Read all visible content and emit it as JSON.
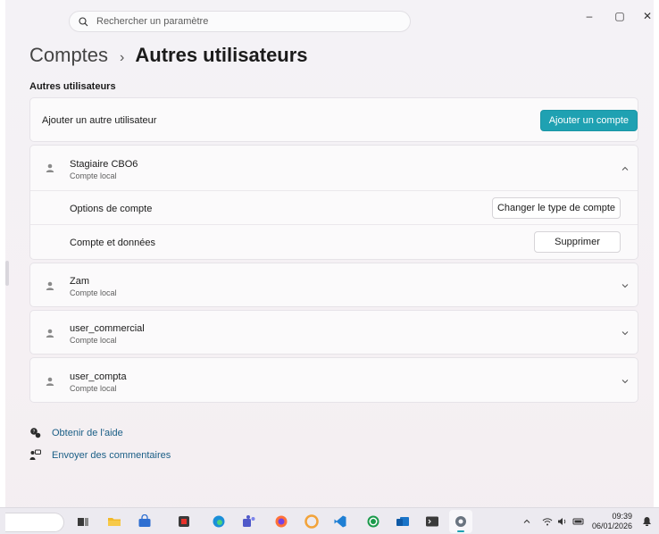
{
  "search": {
    "placeholder": "Rechercher un paramètre"
  },
  "window_controls": {
    "minimize": "–",
    "maximize": "▢",
    "close": "✕"
  },
  "breadcrumb": {
    "parent": "Comptes",
    "separator": "›",
    "current": "Autres utilisateurs"
  },
  "section_title": "Autres utilisateurs",
  "add_user": {
    "label": "Ajouter un autre utilisateur",
    "button": "Ajouter un compte"
  },
  "users": [
    {
      "name": "Stagiaire CBO6",
      "type": "Compte local",
      "expanded": true,
      "options": [
        {
          "label": "Options de compte",
          "button": "Changer le type de compte"
        },
        {
          "label": "Compte et données",
          "button": "Supprimer"
        }
      ]
    },
    {
      "name": "Zam",
      "type": "Compte local",
      "expanded": false
    },
    {
      "name": "user_commercial",
      "type": "Compte local",
      "expanded": false
    },
    {
      "name": "user_compta",
      "type": "Compte local",
      "expanded": false
    }
  ],
  "help_links": [
    {
      "label": "Obtenir de l'aide",
      "icon": "help-icon"
    },
    {
      "label": "Envoyer des commentaires",
      "icon": "feedback-icon"
    }
  ],
  "taskbar": {
    "apps": [
      "task-view-icon",
      "file-explorer-icon",
      "store-icon",
      "app-red-icon",
      "edge-icon",
      "teams-icon",
      "firefox-icon",
      "opera-icon",
      "vscode-icon",
      "whatsapp-icon",
      "outlook-icon",
      "terminal-icon",
      "settings-icon"
    ],
    "time": "09:39",
    "date": "06/01/2026"
  },
  "colors": {
    "accent": "#1fa1b2",
    "link": "#1a5e86"
  }
}
